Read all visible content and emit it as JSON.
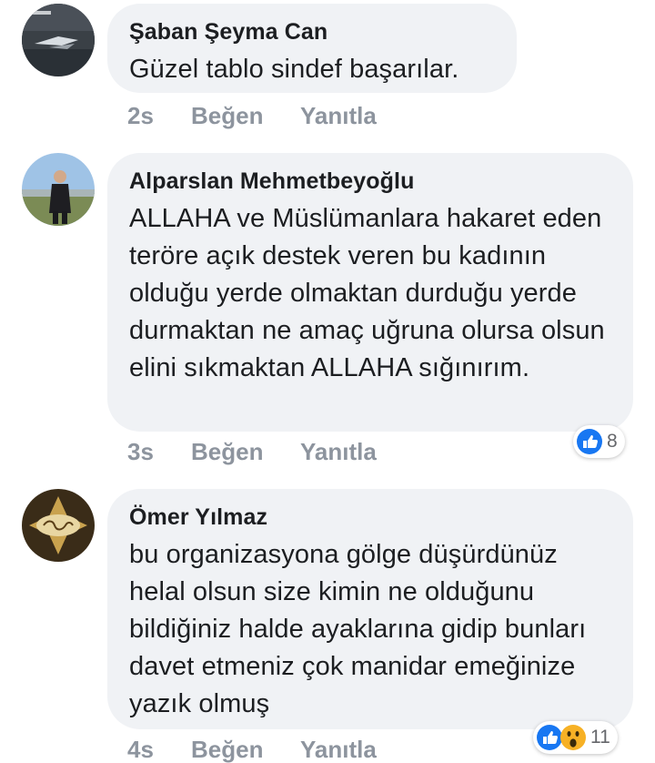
{
  "comments": [
    {
      "author": "Şaban Şeyma Can",
      "text": "Güzel tablo sindef başarılar.",
      "time": "2s",
      "like_label": "Beğen",
      "reply_label": "Yanıtla",
      "avatar": "avatar-night-photo"
    },
    {
      "author": "Alparslan Mehmetbeyoğlu",
      "text": "ALLAHA ve Müslümanlara hakaret eden teröre açık destek veren bu kadının olduğu yerde olmaktan durduğu yerde durmaktan ne amaç uğruna olursa olsun elini sıkmaktan ALLAHA sığınırım.",
      "time": "3s",
      "like_label": "Beğen",
      "reply_label": "Yanıtla",
      "avatar": "avatar-man-outdoors",
      "reactions": {
        "types": [
          "like"
        ],
        "count": "8"
      }
    },
    {
      "author": "Ömer Yılmaz",
      "text": "bu organizasyona gölge düşürdünüz helal olsun size kimin ne olduğunu bildiğiniz halde ayaklarına gidip bunları davet etmeniz çok manidar emeğinize yazık olmuş",
      "time": "4s",
      "like_label": "Beğen",
      "reply_label": "Yanıtla",
      "avatar": "avatar-name-logo",
      "reactions": {
        "types": [
          "like",
          "wow"
        ],
        "count": "11"
      }
    }
  ],
  "colors": {
    "bubble": "#f0f2f5",
    "muted_text": "#8d949e",
    "like_blue": "#1877f2",
    "wow_yellow": "#f7b125"
  }
}
